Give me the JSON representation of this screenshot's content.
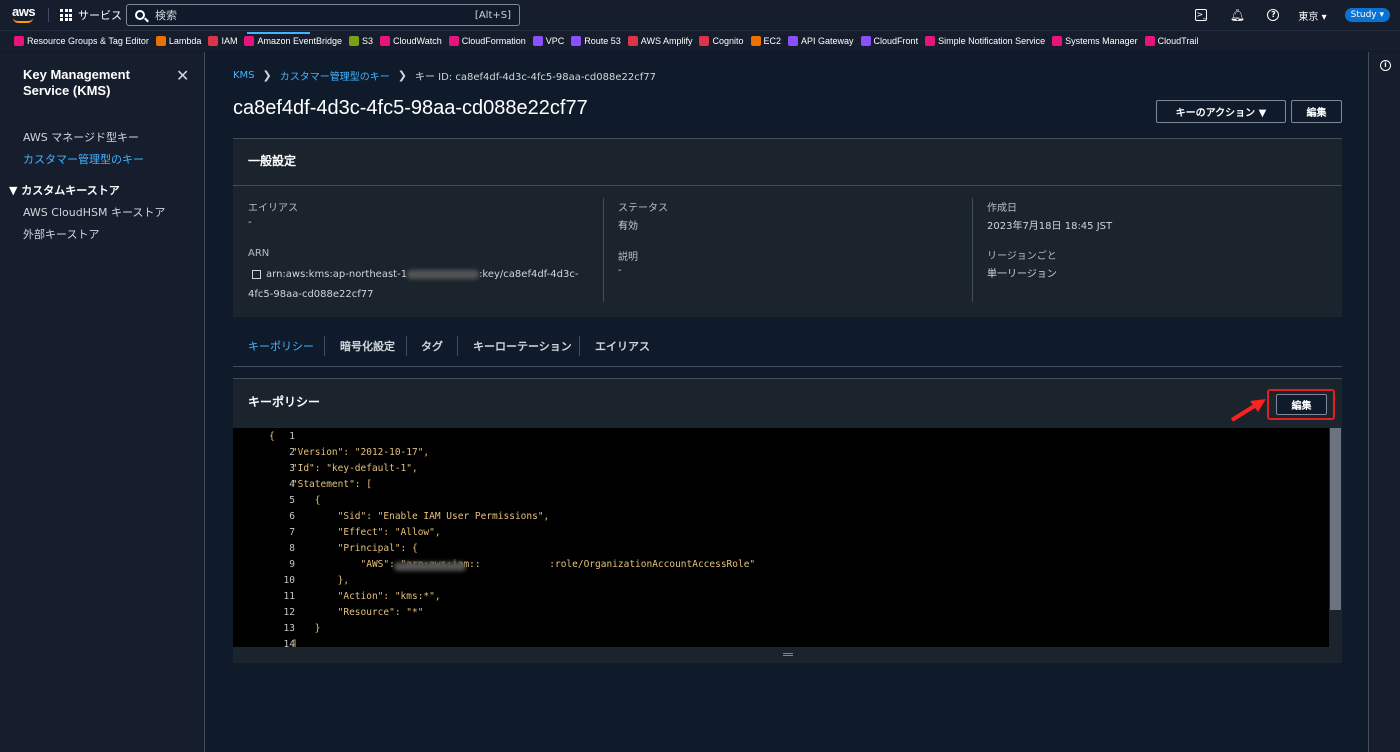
{
  "topnav": {
    "logo": "aws",
    "services_label": "サービス",
    "search_placeholder": "検索",
    "search_shortcut": "[Alt+S]",
    "region": "東京 ▾",
    "account": "Study ▾"
  },
  "favorites": [
    {
      "label": "Resource Groups & Tag Editor",
      "color": "#e7157b"
    },
    {
      "label": "Lambda",
      "color": "#ed7100"
    },
    {
      "label": "IAM",
      "color": "#dd344c"
    },
    {
      "label": "Amazon EventBridge",
      "color": "#e7157b"
    },
    {
      "label": "S3",
      "color": "#7aa116"
    },
    {
      "label": "CloudWatch",
      "color": "#e7157b"
    },
    {
      "label": "CloudFormation",
      "color": "#e7157b"
    },
    {
      "label": "VPC",
      "color": "#8c4fff"
    },
    {
      "label": "Route 53",
      "color": "#8c4fff"
    },
    {
      "label": "AWS Amplify",
      "color": "#dd344c"
    },
    {
      "label": "Cognito",
      "color": "#dd344c"
    },
    {
      "label": "EC2",
      "color": "#ed7100"
    },
    {
      "label": "API Gateway",
      "color": "#8c4fff"
    },
    {
      "label": "CloudFront",
      "color": "#8c4fff"
    },
    {
      "label": "Simple Notification Service",
      "color": "#e7157b"
    },
    {
      "label": "Systems Manager",
      "color": "#e7157b"
    },
    {
      "label": "CloudTrail",
      "color": "#e7157b"
    }
  ],
  "sidebar": {
    "title": "Key Management Service (KMS)",
    "items": [
      {
        "label": "AWS マネージド型キー",
        "active": false
      },
      {
        "label": "カスタマー管理型のキー",
        "active": true
      }
    ],
    "section": "▼ カスタムキーストア",
    "sub_items": [
      {
        "label": "AWS CloudHSM キーストア"
      },
      {
        "label": "外部キーストア"
      }
    ]
  },
  "breadcrumb": {
    "kms": "KMS",
    "customer_keys": "カスタマー管理型のキー",
    "current": "キー ID: ca8ef4df-4d3c-4fc5-98aa-cd088e22cf77"
  },
  "page": {
    "title": "ca8ef4df-4d3c-4fc5-98aa-cd088e22cf77",
    "key_actions": "キーのアクション ▼",
    "edit": "編集"
  },
  "general": {
    "header": "一般設定",
    "alias_label": "エイリアス",
    "alias_value": "-",
    "arn_label": "ARN",
    "arn_prefix": "arn:aws:kms:ap-northeast-1",
    "arn_suffix": ":key/ca8ef4df-4d3c-",
    "arn_line2": "4fc5-98aa-cd088e22cf77",
    "status_label": "ステータス",
    "status_value": "有効",
    "description_label": "説明",
    "description_value": "-",
    "created_label": "作成日",
    "created_value": "2023年7月18日 18:45 JST",
    "region_label": "リージョンごと",
    "region_value": "単一リージョン"
  },
  "tabs": [
    "キーポリシー",
    "暗号化設定",
    "タグ",
    "キーローテーション",
    "エイリアス"
  ],
  "policy": {
    "header": "キーポリシー",
    "edit": "編集",
    "lines": [
      {
        "n": "1",
        "text": "{"
      },
      {
        "n": "2",
        "text": "    \"Version\": \"2012-10-17\","
      },
      {
        "n": "3",
        "text": "    \"Id\": \"key-default-1\","
      },
      {
        "n": "4",
        "text": "    \"Statement\": ["
      },
      {
        "n": "5",
        "text": "        {"
      },
      {
        "n": "6",
        "text": "            \"Sid\": \"Enable IAM User Permissions\","
      },
      {
        "n": "7",
        "text": "            \"Effect\": \"Allow\","
      },
      {
        "n": "8",
        "text": "            \"Principal\": {"
      },
      {
        "n": "9",
        "text": "                \"AWS\": \"arn:aws:iam::            :role/OrganizationAccountAccessRole\""
      },
      {
        "n": "10",
        "text": "            },"
      },
      {
        "n": "11",
        "text": "            \"Action\": \"kms:*\","
      },
      {
        "n": "12",
        "text": "            \"Resource\": \"*\""
      },
      {
        "n": "13",
        "text": "        }"
      },
      {
        "n": "14",
        "text": "    ]"
      }
    ]
  }
}
